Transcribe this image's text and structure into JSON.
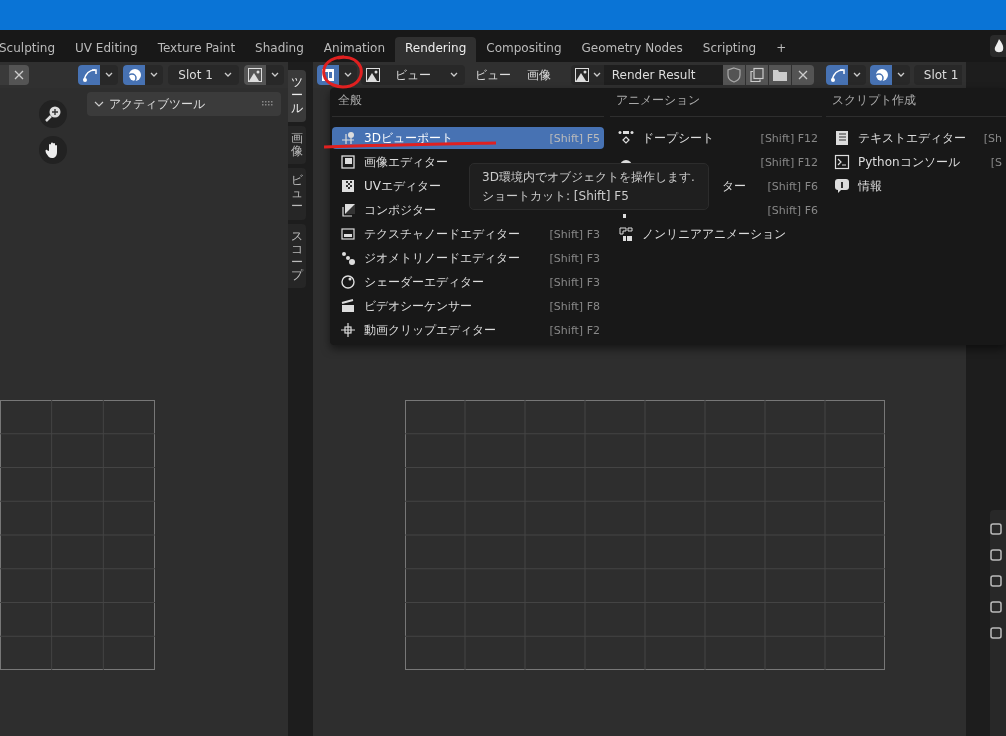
{
  "tabs": [
    {
      "label": "Sculpting",
      "selected": false
    },
    {
      "label": "UV Editing",
      "selected": false
    },
    {
      "label": "Texture Paint",
      "selected": false
    },
    {
      "label": "Shading",
      "selected": false
    },
    {
      "label": "Animation",
      "selected": false
    },
    {
      "label": "Rendering",
      "selected": true
    },
    {
      "label": "Compositing",
      "selected": false
    },
    {
      "label": "Geometry Nodes",
      "selected": false
    },
    {
      "label": "Scripting",
      "selected": false
    },
    {
      "label": "+",
      "selected": false
    }
  ],
  "left_header": {
    "slot": "Slot 1"
  },
  "left_panel": {
    "title": "アクティブツール",
    "expanded": true
  },
  "side_tabs": [
    {
      "label": "ツール",
      "selected": true
    },
    {
      "label": "画像",
      "selected": false
    },
    {
      "label": "ビュー",
      "selected": false
    },
    {
      "label": "スコープ",
      "selected": false
    }
  ],
  "right_header": {
    "view_dropdown": "ビュー",
    "menus": [
      "ビュー",
      "画像"
    ],
    "image_name": "Render Result",
    "slot": "Slot 1"
  },
  "editor_menu": {
    "columns": [
      {
        "title": "全般",
        "items": [
          {
            "label": "3Dビューポート",
            "shortcut": "[Shift] F5",
            "selected": true
          },
          {
            "label": "画像エディター",
            "selected": false
          },
          {
            "label": "UVエディター",
            "selected": false
          },
          {
            "label": "コンポジター",
            "selected": false
          },
          {
            "label": "テクスチャノードエディター",
            "shortcut": "[Shift] F3",
            "selected": false
          },
          {
            "label": "ジオメトリノードエディター",
            "shortcut": "[Shift] F3",
            "selected": false
          },
          {
            "label": "シェーダーエディター",
            "shortcut": "[Shift] F3",
            "selected": false
          },
          {
            "label": "ビデオシーケンサー",
            "shortcut": "[Shift] F8",
            "selected": false
          },
          {
            "label": "動画クリップエディター",
            "shortcut": "[Shift] F2",
            "selected": false
          }
        ]
      },
      {
        "title": "アニメーション",
        "items": [
          {
            "label": "ドープシート",
            "shortcut": "[Shift] F12",
            "selected": false
          },
          {
            "shortcut": "[Shift] F12",
            "selected": false
          },
          {
            "label": "ター",
            "shortcut": "[Shift] F6",
            "selected": false
          },
          {
            "shortcut": "[Shift] F6",
            "selected": false
          },
          {
            "label": "ノンリニアアニメーション",
            "selected": false
          }
        ]
      },
      {
        "title": "スクリプト作成",
        "items": [
          {
            "label": "テキストエディター",
            "shortcut": "[Sh",
            "selected": false
          },
          {
            "label": "Pythonコンソール",
            "shortcut": "[S",
            "selected": false
          },
          {
            "label": "情報",
            "selected": false
          }
        ]
      }
    ]
  },
  "tooltip": {
    "lines": [
      "3D環境内でオブジェクトを操作します.",
      "ショートカット: [Shift] F5"
    ]
  }
}
